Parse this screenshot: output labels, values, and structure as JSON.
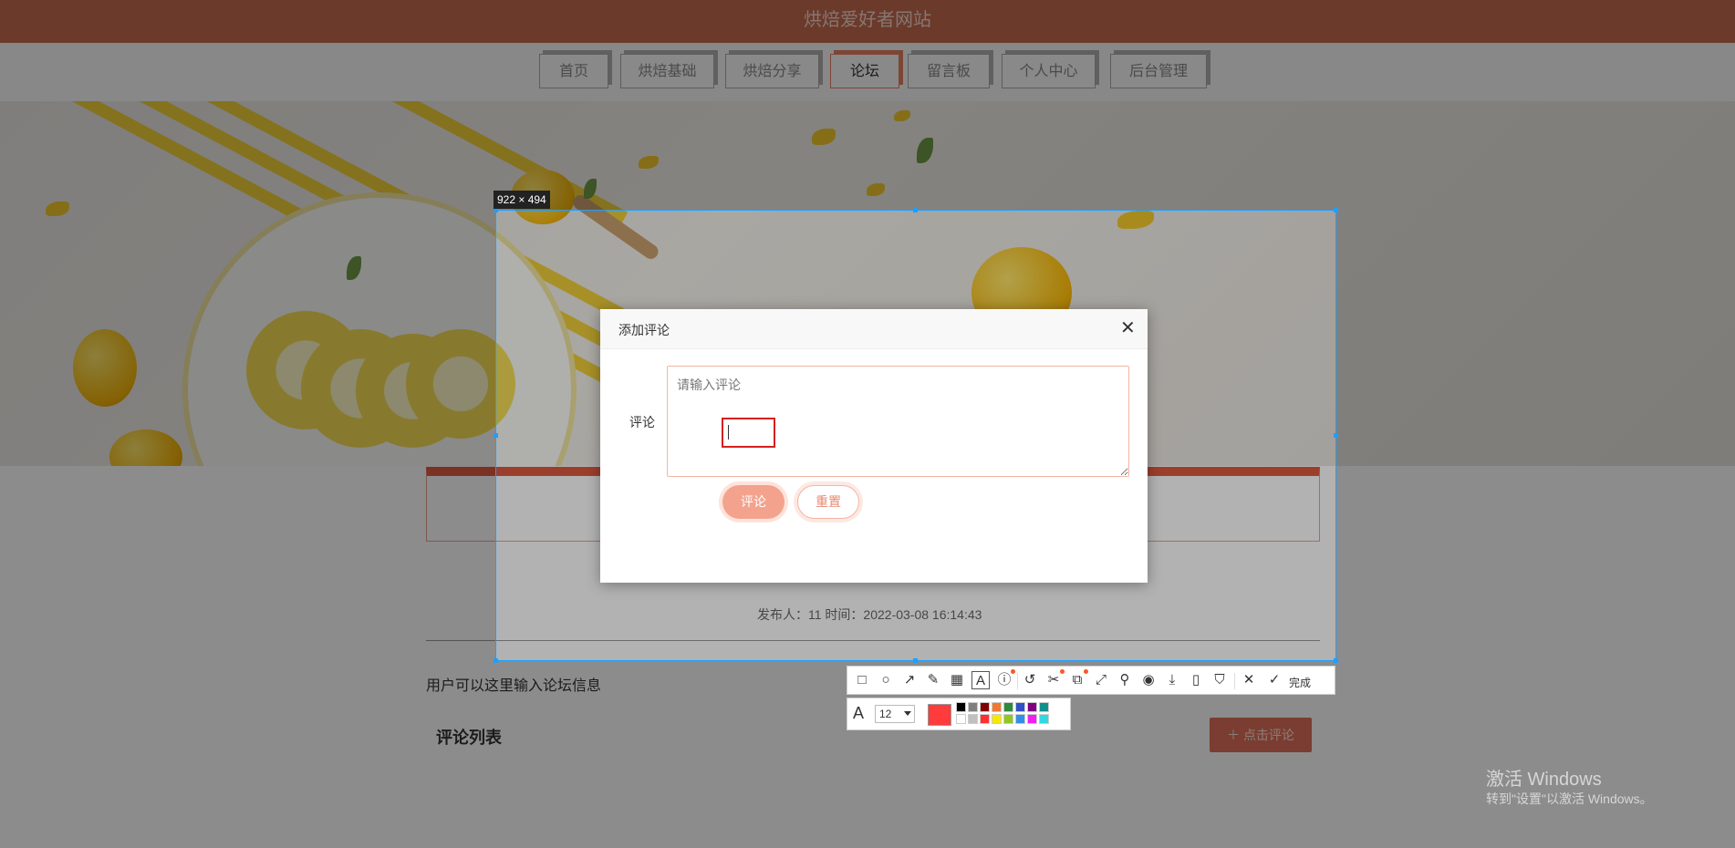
{
  "site": {
    "title": "烘焙爱好者网站",
    "nav": [
      {
        "label": "首页",
        "active": false
      },
      {
        "label": "烘焙基础",
        "active": false
      },
      {
        "label": "烘焙分享",
        "active": false
      },
      {
        "label": "论坛",
        "active": true
      },
      {
        "label": "留言板",
        "active": false
      },
      {
        "label": "个人中心",
        "active": false
      },
      {
        "label": "后台管理",
        "active": false
      }
    ]
  },
  "post": {
    "meta": "发布人：11 时间：2022-03-08 16:14:43",
    "body": "用户可以这里输入论坛信息",
    "comments_heading": "评论列表",
    "add_comment_label": "点击评论"
  },
  "dialog": {
    "title": "添加评论",
    "field_label": "评论",
    "placeholder": "请输入评论",
    "value": "",
    "submit_label": "评论",
    "reset_label": "重置"
  },
  "screenshot_tool": {
    "selection_size": "922 × 494",
    "done_label": "完成",
    "font_size": "12",
    "current_color": "#ff3b3b",
    "palette": [
      "#000000",
      "#808080",
      "#800000",
      "#f07830",
      "#2e8b3c",
      "#3050c8",
      "#800080",
      "#10908c",
      "#ffffff",
      "#c0c0c0",
      "#ff3030",
      "#f8e800",
      "#90c820",
      "#3090e8",
      "#f020f0",
      "#30d8e0"
    ]
  },
  "os": {
    "watermark_title": "激活 Windows",
    "watermark_sub": "转到\"设置\"以激活 Windows。"
  }
}
